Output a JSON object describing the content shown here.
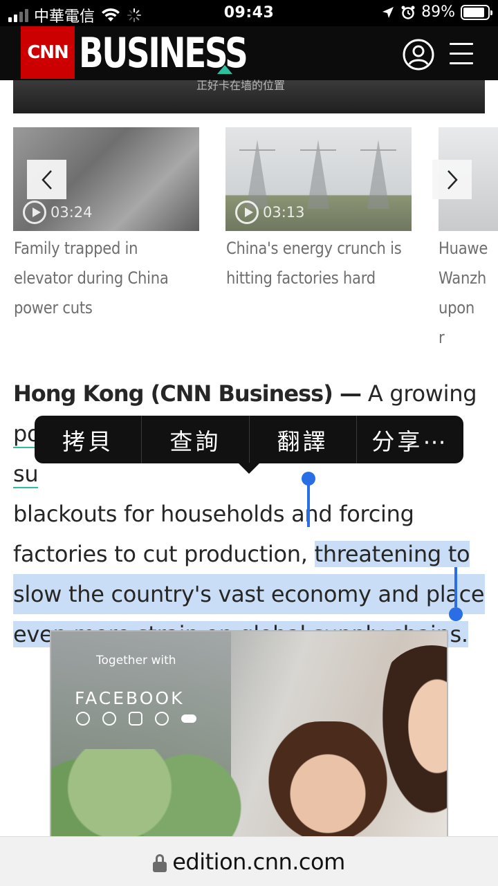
{
  "status_bar": {
    "carrier": "中華電信",
    "time": "09:43",
    "battery": "89%",
    "battery_level": 0.89
  },
  "header": {
    "logo_text": "CNN",
    "section": "BUSINESS"
  },
  "top_image": {
    "caption": "正好卡在墙的位置"
  },
  "carousel": [
    {
      "title": "Family trapped in elevator during China power cuts",
      "duration": "03:24"
    },
    {
      "title": "China's energy crunch is hitting factories hard",
      "duration": "03:13"
    },
    {
      "title": "Huawe Wanzh upon r"
    }
  ],
  "article": {
    "dateline": "Hong Kong (CNN Business) —",
    "lead_plain": " A growing ",
    "link_word": "power",
    "line2_start": "su",
    "line3": "blackouts for households and forcing",
    "line4_plain": "factories to cut production, ",
    "selected_text_1": "threatening to",
    "selected_text_2": "slow the country's vast economy and place",
    "selected_text_3": "even more strain on global supply chains."
  },
  "context_menu": {
    "items": [
      "拷貝",
      "查詢",
      "翻譯",
      "分享⋯"
    ]
  },
  "ad": {
    "together_with": "Together with",
    "brand": "FACEBOOK"
  },
  "url_bar": {
    "domain": "edition.cnn.com"
  },
  "colors": {
    "cnn_red": "#cc0000",
    "accent_green": "#2bc19e",
    "selection": "#c9def6",
    "selection_handle": "#2a6ee6"
  }
}
